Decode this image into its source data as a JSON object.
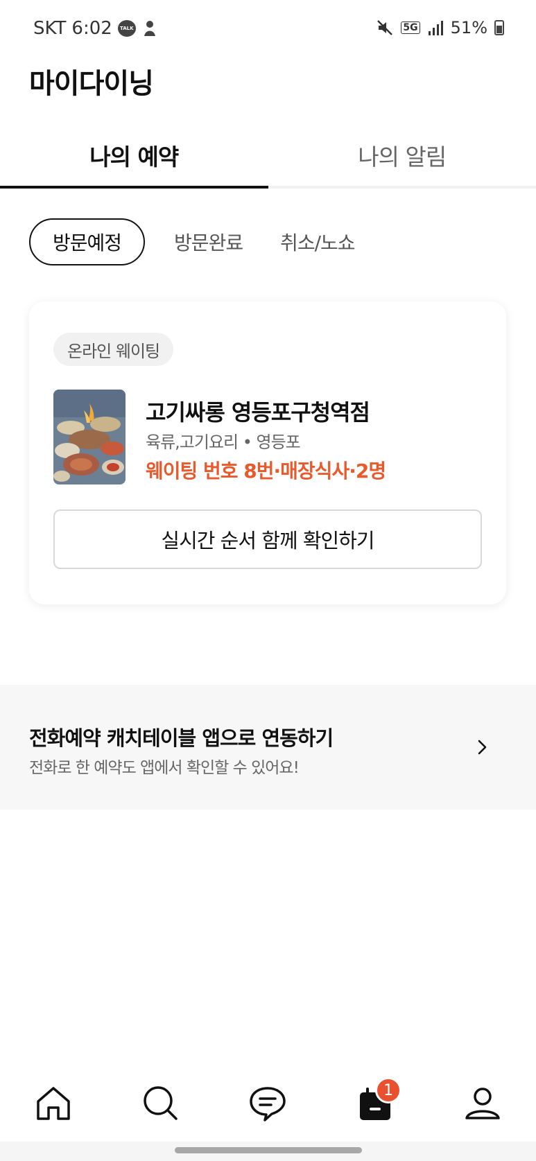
{
  "status_bar": {
    "carrier": "SKT",
    "time": "6:02",
    "talk_label": "TALK",
    "network": "5G",
    "battery": "51%"
  },
  "header": {
    "title": "마이다이닝"
  },
  "main_tabs": [
    {
      "label": "나의 예약",
      "active": true
    },
    {
      "label": "나의 알림",
      "active": false
    }
  ],
  "sub_tabs": [
    {
      "label": "방문예정",
      "active": true
    },
    {
      "label": "방문완료",
      "active": false
    },
    {
      "label": "취소/노쇼",
      "active": false
    }
  ],
  "reservation_card": {
    "badge": "온라인 웨이팅",
    "store_name": "고기싸롱 영등포구청역점",
    "meta": "육류,고기요리 • 영등포",
    "waiting_info": "웨이팅 번호 8번·매장식사·2명",
    "button_label": "실시간 순서 함께 확인하기"
  },
  "banner": {
    "title": "전화예약 캐치테이블 앱으로 연동하기",
    "subtitle": "전화로 한 예약도 앱에서 확인할 수 있어요!"
  },
  "bottom_nav": {
    "items": [
      {
        "icon": "home-icon",
        "active": false
      },
      {
        "icon": "search-icon",
        "active": false
      },
      {
        "icon": "chat-icon",
        "active": false
      },
      {
        "icon": "calendar-icon",
        "active": true,
        "badge": "1"
      },
      {
        "icon": "profile-icon",
        "active": false
      }
    ]
  },
  "colors": {
    "accent": "#e85a2c",
    "badge": "#e9502f",
    "text": "#111111"
  }
}
